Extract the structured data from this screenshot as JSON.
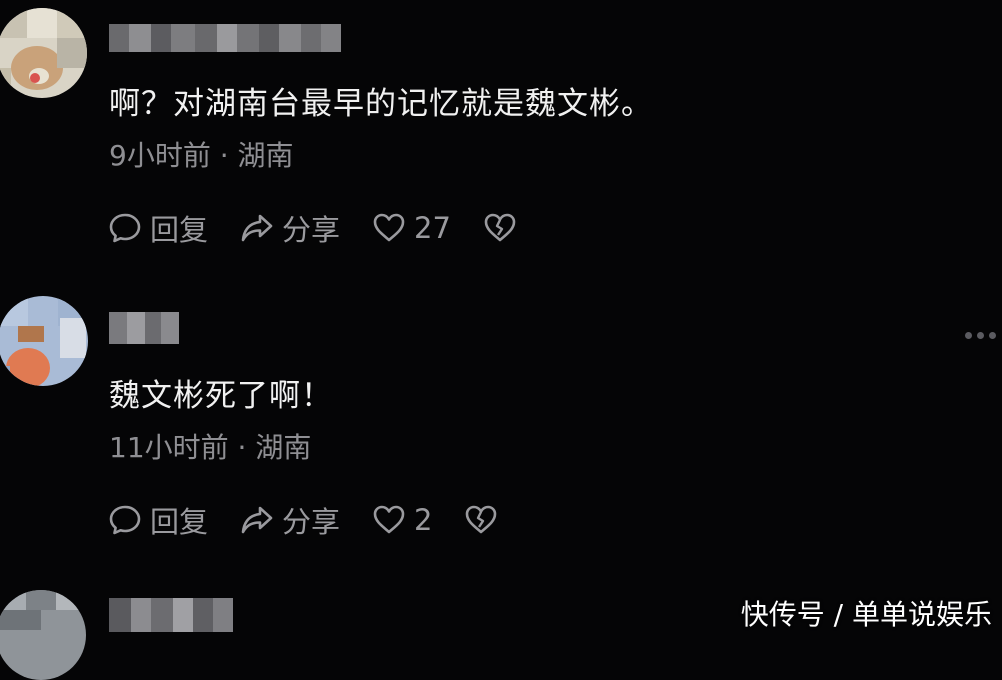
{
  "comments": [
    {
      "text": "啊？对湖南台最早的记忆就是魏文彬。",
      "meta": "9小时前 · 湖南",
      "reply_label": "回复",
      "share_label": "分享",
      "like_count": "27"
    },
    {
      "text": "魏文彬死了啊！",
      "meta": "11小时前 · 湖南",
      "reply_label": "回复",
      "share_label": "分享",
      "like_count": "2"
    }
  ],
  "watermark": "快传号 / 单单说娱乐",
  "icons": {
    "reply": "comment-bubble-icon",
    "share": "share-arrow-icon",
    "like": "heart-icon",
    "dislike": "broken-heart-icon",
    "more": "more-dots-icon"
  },
  "colors": {
    "background": "#050506",
    "text": "#f1f1f1",
    "muted": "#8f8f93"
  }
}
